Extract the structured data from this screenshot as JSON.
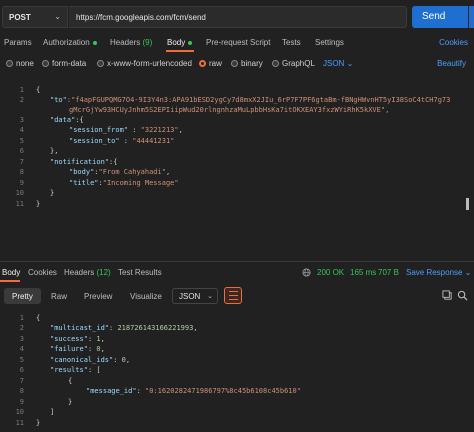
{
  "request": {
    "method": "POST",
    "url": "https://fcm.googleapis.com/fcm/send",
    "send_label": "Send"
  },
  "request_tabs": {
    "params": "Params",
    "authorization": "Authorization",
    "headers": "Headers",
    "headers_count": "(9)",
    "body": "Body",
    "pre_request": "Pre-request Script",
    "tests": "Tests",
    "settings": "Settings",
    "cookies": "Cookies"
  },
  "body_types": {
    "none": "none",
    "form_data": "form-data",
    "urlencoded": "x-www-form-urlencoded",
    "raw": "raw",
    "binary": "binary",
    "graphql": "GraphQL",
    "format": "JSON",
    "beautify": "Beautify"
  },
  "editor": {
    "line_numbers": [
      "1",
      "2",
      "",
      "3",
      "4",
      "5",
      "6",
      "7",
      "8",
      "9",
      "10",
      "11"
    ],
    "lines": {
      "l1": "{",
      "l2_key": "\"to\"",
      "l2_val": ":\"f4apFGUPQMG7O4-9I3Y4n3:APA91bESD2ygCy7d8mxX2JIu_6rP7F7PF6gtaBm-fBNgHWvnHT5yI38SoC4tCH7g73",
      "l2_cont": "gMcrGjYw93HCUyJnhm5S2EPIiipWud20rlngnhzaMuLpbbHsKa7itOKXEAY3fxzWYiRhK5kXVE\",",
      "l3_key": "\"data\"",
      "l3_rest": ":{",
      "l4_key": "\"session_from\"",
      "l4_val": "\"3221213\"",
      "l5_key": "\"session_to\"",
      "l5_val": "\"44441231\"",
      "l6": "},",
      "l7_key": "\"notification\"",
      "l7_rest": ":{",
      "l8_key": "\"body\"",
      "l8_val": "\"From Cahyahadi\"",
      "l9_key": "\"title\"",
      "l9_val": "\"Incoming Message\"",
      "l10": "}",
      "l11": "}"
    }
  },
  "response_tabs": {
    "body": "Body",
    "cookies": "Cookies",
    "headers": "Headers",
    "headers_count": "(12)",
    "test_results": "Test Results",
    "status": "200 OK",
    "time": "165 ms",
    "size": "707 B",
    "save": "Save Response"
  },
  "response_toolbar": {
    "pretty": "Pretty",
    "raw": "Raw",
    "preview": "Preview",
    "visualize": "Visualize",
    "format": "JSON"
  },
  "response": {
    "line_numbers": [
      "1",
      "2",
      "3",
      "4",
      "5",
      "6",
      "7",
      "8",
      "9",
      "10",
      "11"
    ],
    "l1": "{",
    "l2_key": "\"multicast_id\"",
    "l2_val": "218726143166221993",
    "l3_key": "\"success\"",
    "l3_val": "1",
    "l4_key": "\"failure\"",
    "l4_val": "0",
    "l5_key": "\"canonical_ids\"",
    "l5_val": "0",
    "l6_key": "\"results\"",
    "l6_rest": ": [",
    "l7": "{",
    "l8_key": "\"message_id\"",
    "l8_val": "\"0:1620282471986797%8c45b6108c45b610\"",
    "l9": "}",
    "l10": "]",
    "l11": "}"
  },
  "colors": {
    "accent": "#f26b3a",
    "send": "#1f6fd1",
    "link": "#4b9dff",
    "ok": "#34c759"
  }
}
